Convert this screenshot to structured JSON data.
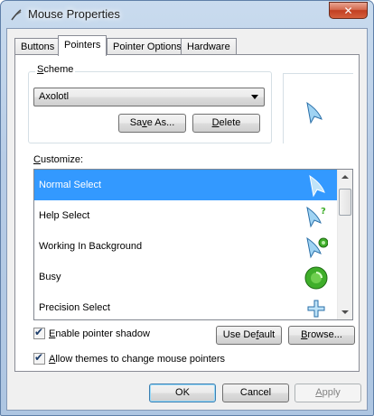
{
  "window": {
    "title": "Mouse Properties",
    "close_glyph": "✕"
  },
  "tabs": [
    {
      "label": "Buttons",
      "active": false
    },
    {
      "label": "Pointers",
      "active": true
    },
    {
      "label": "Pointer Options",
      "active": false
    },
    {
      "label": "Hardware",
      "active": false
    }
  ],
  "scheme": {
    "label_accel": "S",
    "label_rest": "cheme",
    "selected_value": "Axolotl",
    "save_as": {
      "accel": "v",
      "pre": "Sa",
      "post": "e As..."
    },
    "delete": {
      "accel": "D",
      "post": "elete"
    }
  },
  "customize": {
    "label_accel": "C",
    "label_rest": "ustomize:",
    "items": [
      {
        "label": "Normal Select",
        "icon": "arrow-cursor-icon",
        "selected": true
      },
      {
        "label": "Help Select",
        "icon": "help-cursor-icon",
        "selected": false
      },
      {
        "label": "Working In Background",
        "icon": "working-cursor-icon",
        "selected": false
      },
      {
        "label": "Busy",
        "icon": "busy-cursor-icon",
        "selected": false
      },
      {
        "label": "Precision Select",
        "icon": "crosshair-cursor-icon",
        "selected": false
      }
    ]
  },
  "options": {
    "shadow": {
      "accel": "E",
      "rest": "nable pointer shadow",
      "checked": true
    },
    "themes": {
      "accel": "A",
      "rest": "llow themes to change mouse pointers",
      "checked": true
    },
    "use_default": {
      "pre": "Use De",
      "accel": "f",
      "post": "ault"
    },
    "browse": {
      "accel": "B",
      "post": "rowse..."
    }
  },
  "footer": {
    "ok": "OK",
    "cancel": "Cancel",
    "apply": {
      "accel": "A",
      "post": "pply",
      "enabled": false
    }
  },
  "colors": {
    "selection": "#3399ff",
    "cursor_fill": "#9fd3f3",
    "busy_green": "#3fae2a"
  }
}
